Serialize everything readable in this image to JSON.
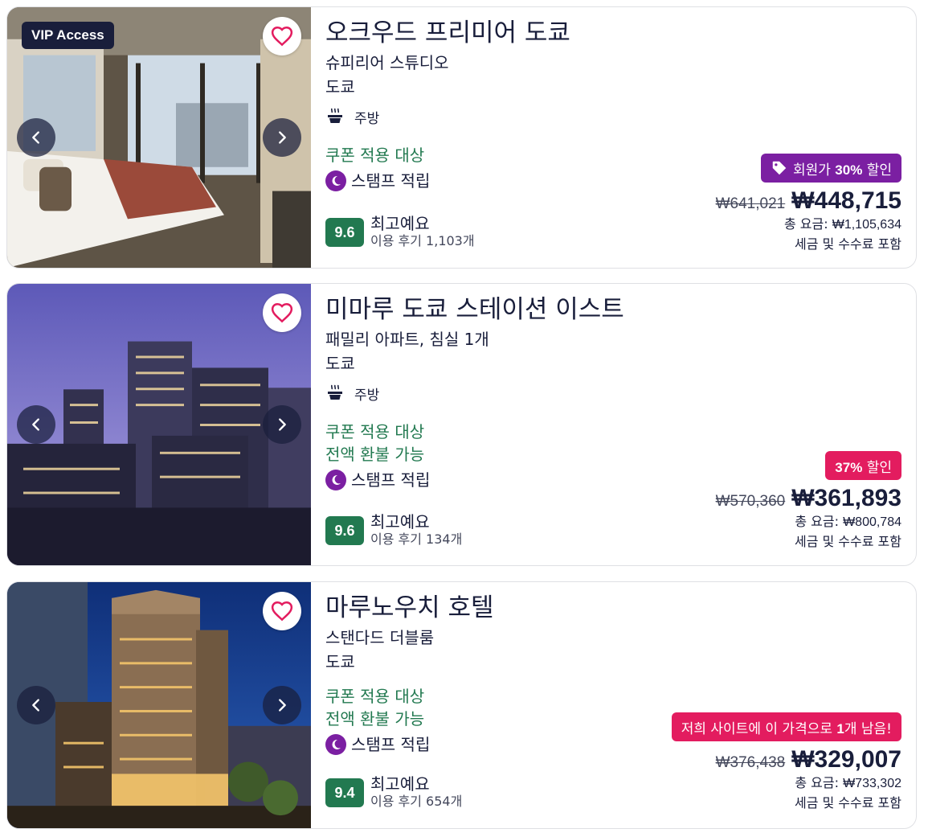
{
  "colors": {
    "text": "#191e3b",
    "green": "#227950",
    "member_purple": "#7b1fa2",
    "deal_red": "#e31c5f",
    "heart": "#e31c5f"
  },
  "icons": {
    "favorite": "heart-outline-icon",
    "prev": "chevron-left-icon",
    "next": "chevron-right-icon",
    "kitchen": "kitchen-icon",
    "stamp": "moon-stamp-icon",
    "tag": "tag-icon"
  },
  "listings": [
    {
      "vip_badge": "VIP Access",
      "name": "오크우드 프리미어 도쿄",
      "room": "슈피리어 스튜디오",
      "city": "도쿄",
      "amenity": "주방",
      "perks": [
        "쿠폰 적용 대상"
      ],
      "stamp": "스탬프 적립",
      "score": "9.6",
      "rating_label": "최고예요",
      "review_count": "이용 후기 1,103개",
      "badge_prefix": "회원가 ",
      "badge_bold": "30%",
      "badge_suffix": " 할인",
      "old_price": "₩641,021",
      "price": "₩448,715",
      "total_label": "총 요금: ",
      "total_value": "₩1,105,634",
      "tax_note": "세금 및 수수료 포함"
    },
    {
      "name": "미마루 도쿄 스테이션 이스트",
      "room": "패밀리 아파트, 침실 1개",
      "city": "도쿄",
      "amenity": "주방",
      "perks": [
        "쿠폰 적용 대상",
        "전액 환불 가능"
      ],
      "stamp": "스탬프 적립",
      "score": "9.6",
      "rating_label": "최고예요",
      "review_count": "이용 후기 134개",
      "badge_bold": "37%",
      "badge_suffix": " 할인",
      "old_price": "₩570,360",
      "price": "₩361,893",
      "total_label": "총 요금: ",
      "total_value": "₩800,784",
      "tax_note": "세금 및 수수료 포함"
    },
    {
      "name": "마루노우치 호텔",
      "room": "스탠다드 더블룸",
      "city": "도쿄",
      "perks": [
        "쿠폰 적용 대상",
        "전액 환불 가능"
      ],
      "stamp": "스탬프 적립",
      "score": "9.4",
      "rating_label": "최고예요",
      "review_count": "이용 후기 654개",
      "badge_prefix": "저희 사이트에 이 가격으로 ",
      "badge_bold": "1",
      "badge_suffix": "개 남음!",
      "old_price": "₩376,438",
      "price": "₩329,007",
      "total_label": "총 요금: ",
      "total_value": "₩733,302",
      "tax_note": "세금 및 수수료 포함"
    }
  ]
}
